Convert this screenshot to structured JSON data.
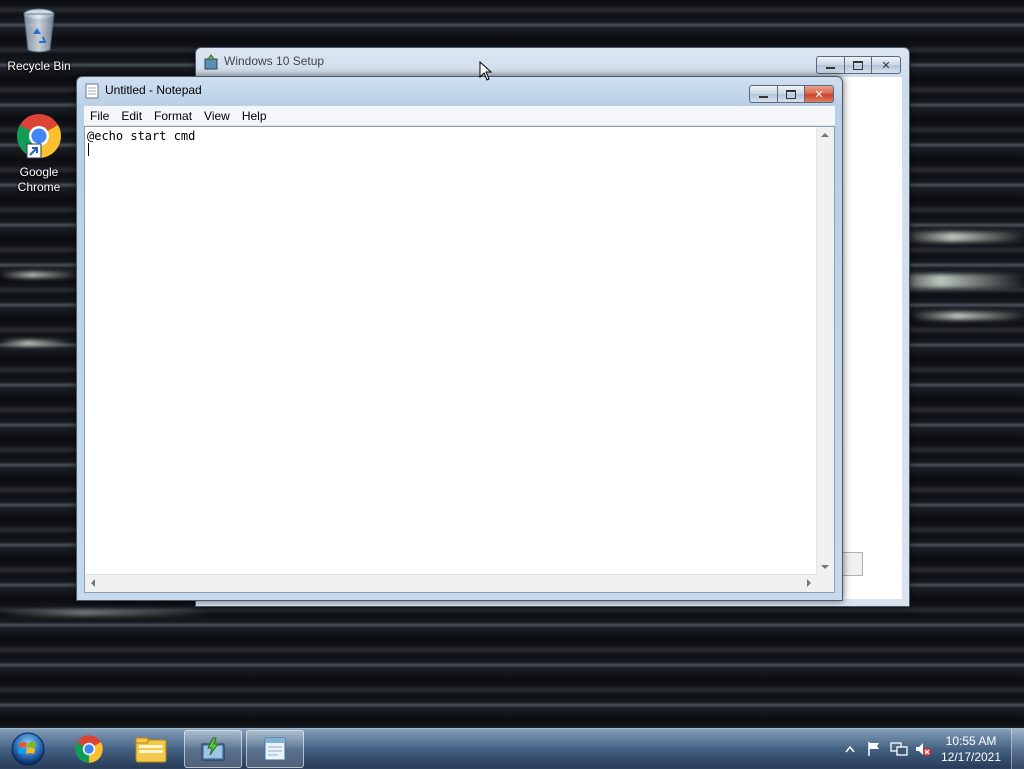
{
  "desktop": {
    "icons": [
      {
        "label": "Recycle Bin"
      },
      {
        "label": "Google Chrome"
      }
    ]
  },
  "setup_window": {
    "title": "Windows 10 Setup"
  },
  "notepad": {
    "title": "Untitled - Notepad",
    "menu": [
      "File",
      "Edit",
      "Format",
      "View",
      "Help"
    ],
    "content": "@echo start cmd"
  },
  "taskbar": {
    "pinned": [
      {
        "icon": "windows-start-orb-icon"
      },
      {
        "icon": "chrome-icon"
      },
      {
        "icon": "file-explorer-icon"
      },
      {
        "icon": "windows-setup-icon"
      },
      {
        "icon": "notepad-icon"
      }
    ],
    "tray_icons": [
      "show-hidden-icons-icon",
      "action-center-flag-icon",
      "network-icon",
      "volume-muted-icon"
    ],
    "clock": {
      "time": "10:55 AM",
      "date": "12/17/2021"
    }
  }
}
